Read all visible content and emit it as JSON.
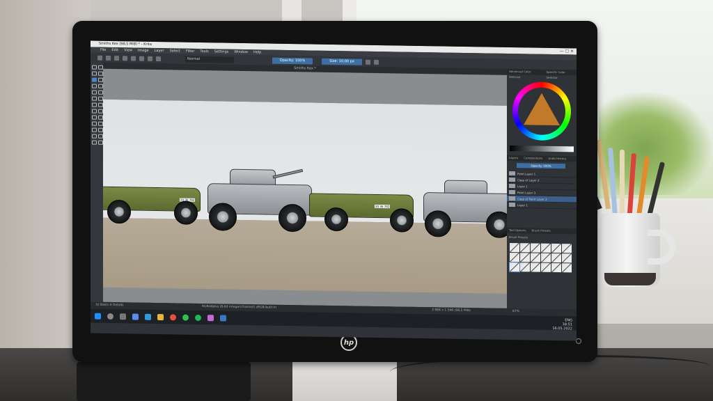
{
  "window": {
    "title": "Smiths Kex (98,5 MiB) * - Krita",
    "controls": "—  ☐  ✕"
  },
  "menu": [
    "File",
    "Edit",
    "View",
    "Image",
    "Layer",
    "Select",
    "Filter",
    "Tools",
    "Settings",
    "Window",
    "Help"
  ],
  "toolbar": {
    "blend_mode": "Normal",
    "opacity": "Opacity: 100%",
    "size": "Size: 10,00 px"
  },
  "document_tab": "Smiths Kex *",
  "dockers": {
    "color_tabs": [
      "Advanced Color Selector",
      "Specific Color Selector"
    ],
    "layer_tabs": [
      "Layers",
      "Compositions",
      "Undo History"
    ],
    "layer_opacity": "Opacity: 100%",
    "layers": [
      {
        "name": "Paint Layer 1",
        "selected": false
      },
      {
        "name": "Copy of Layer 2",
        "selected": false
      },
      {
        "name": "Layer 1",
        "selected": false
      },
      {
        "name": "Paint Layer 3",
        "selected": false
      },
      {
        "name": "Copy of Paint Layer 2",
        "selected": true
      },
      {
        "name": "Layer 1",
        "selected": false
      }
    ],
    "brush_tabs": [
      "Tool Options",
      "Brush Presets"
    ],
    "brush_presets_label": "Brush Presets",
    "zoom": "67%"
  },
  "status": {
    "left": "b) Basic-4 Details",
    "mid": "RGB/Alpha (8-bit integer/channel)  sRGB-built-in",
    "dims": "3 984 x 1 546 (98,5 MiB)"
  },
  "tray": {
    "lang": "ENG",
    "time": "18:51",
    "date": "16.05.2022"
  },
  "art": {
    "plate_a": "20 36 782",
    "plate_b": "20 36 782"
  }
}
